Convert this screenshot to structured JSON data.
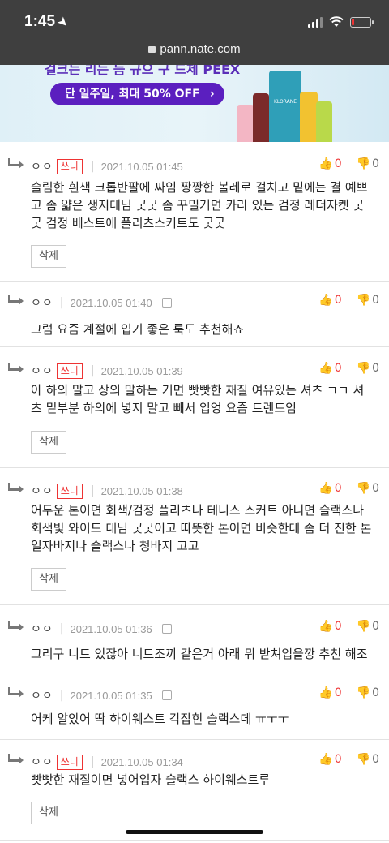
{
  "status_bar": {
    "time": "1:45"
  },
  "browser": {
    "url": "pann.nate.com"
  },
  "banner": {
    "cut_text": "걸크는 리는 듬 규으 구 드제 PEEX",
    "pill_text": "단 일주일, 최대 50% OFF",
    "pill_chevron": "›",
    "brand": "KLORANE"
  },
  "colors": {
    "accent": "#e33333",
    "banner_pill": "#5b1fbf"
  },
  "comments": [
    {
      "nick": "ㅇㅇ",
      "badge": "쓰니",
      "date": "2021.10.05 01:45",
      "up": "0",
      "down": "0",
      "text": "슬림한 흰색 크롭반팔에 짜임 짱짱한 볼레로 걸치고 밑에는 결 예쁘고 좀 얇은 생지데님 굿굿 좀 꾸밀거면 카라 있는 검정 레더자켓 굿굿 검정 베스트에 플리츠스커트도 굿굿",
      "delete": "삭제"
    },
    {
      "nick": "ㅇㅇ",
      "badge": "",
      "date": "2021.10.05 01:40",
      "up": "0",
      "down": "0",
      "text": "그럼 요즘 계절에 입기 좋은 룩도 추천해죠"
    },
    {
      "nick": "ㅇㅇ",
      "badge": "쓰니",
      "date": "2021.10.05 01:39",
      "up": "0",
      "down": "0",
      "text": "아 하의 말고 상의 말하는 거면 빳빳한 재질 여유있는 셔츠 ㄱㄱ 셔츠 밑부분 하의에 넣지 말고 빼서 입엉 요즘 트렌드임",
      "delete": "삭제"
    },
    {
      "nick": "ㅇㅇ",
      "badge": "쓰니",
      "date": "2021.10.05 01:38",
      "up": "0",
      "down": "0",
      "text": "어두운 톤이면 회색/검정 플리츠나 테니스 스커트 아니면 슬랙스나 회색빛 와이드 데님 굿굿이고 따뜻한 톤이면 비슷한데 좀 더 진한 톤 일자바지나 슬랙스나 청바지 고고",
      "delete": "삭제"
    },
    {
      "nick": "ㅇㅇ",
      "badge": "",
      "date": "2021.10.05 01:36",
      "up": "0",
      "down": "0",
      "text": "그리구 니트 있잖아 니트조끼 같은거 아래 뭐 받쳐입을깡 추천 해조"
    },
    {
      "nick": "ㅇㅇ",
      "badge": "",
      "date": "2021.10.05 01:35",
      "up": "0",
      "down": "0",
      "text": "어케 알았어 딱 하이웨스트 각잡힌 슬랙스데 ㅠㅜㅜ"
    },
    {
      "nick": "ㅇㅇ",
      "badge": "쓰니",
      "date": "2021.10.05 01:34",
      "up": "0",
      "down": "0",
      "text": "빳빳한 재질이면 넣어입자 슬랙스 하이웨스트루",
      "delete": "삭제"
    }
  ]
}
